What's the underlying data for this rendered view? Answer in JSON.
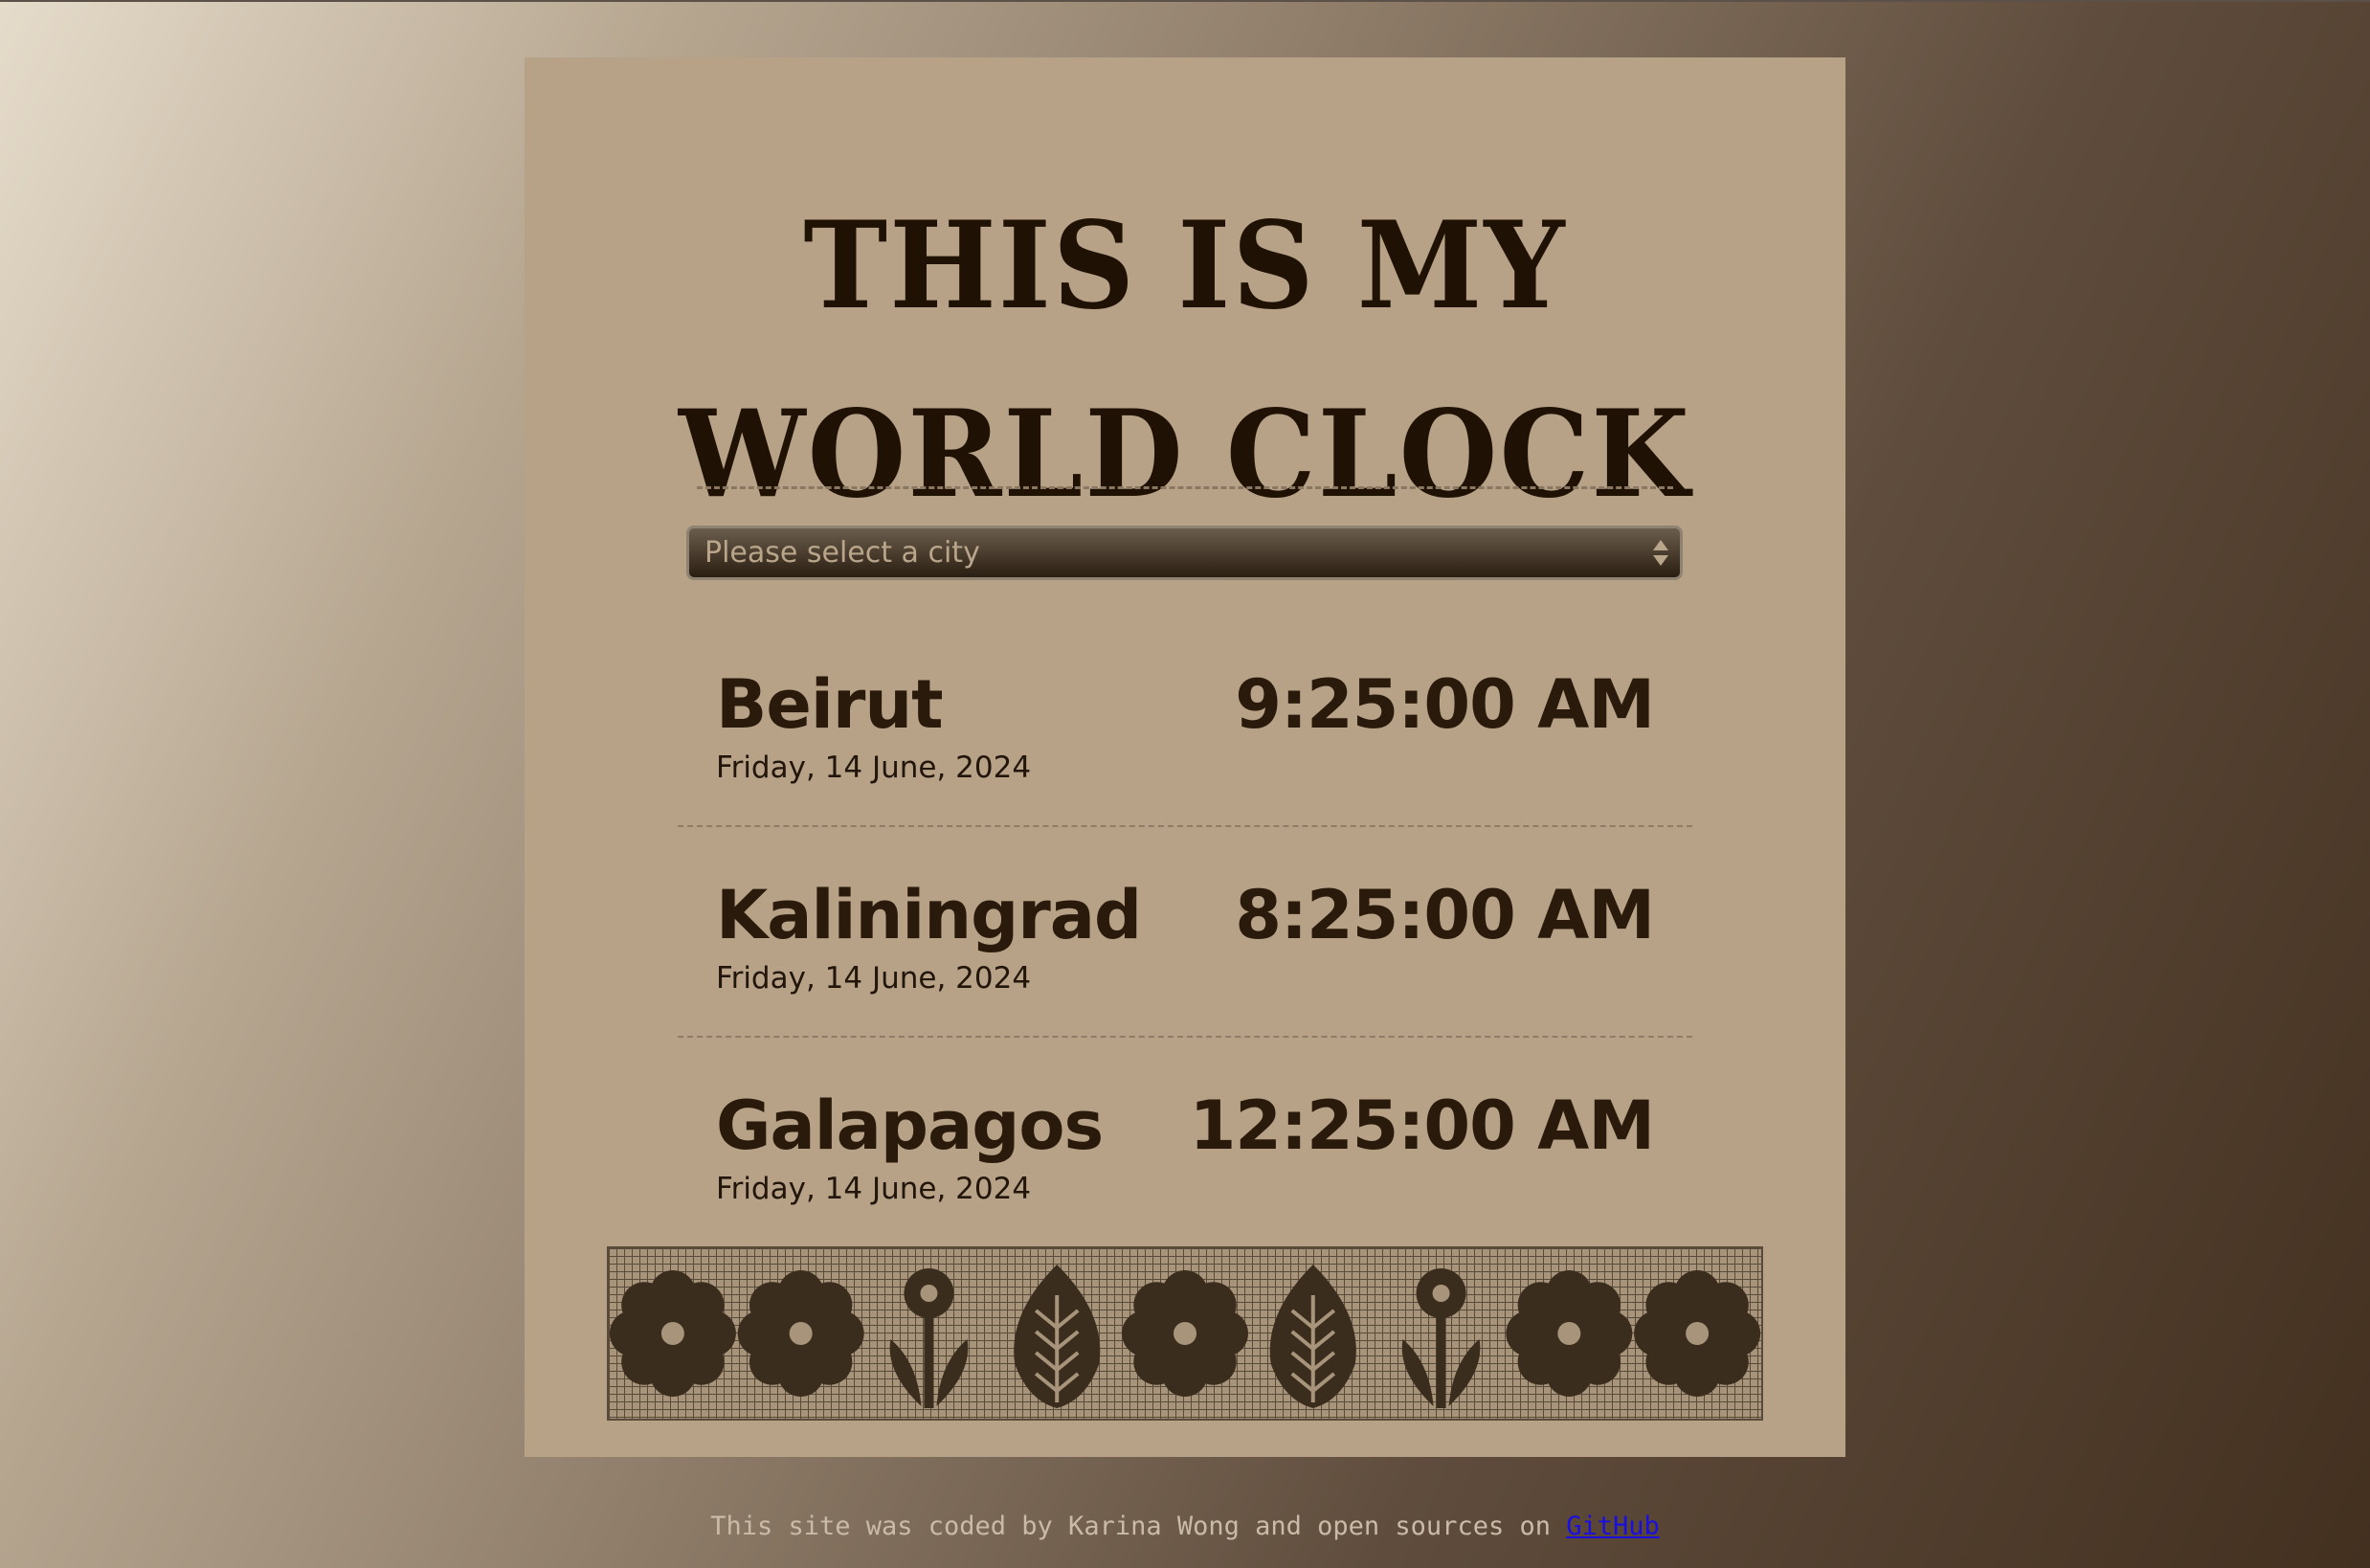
{
  "header": {
    "title_line1": "This is my",
    "title_line2": "World Clock"
  },
  "city_select": {
    "placeholder": "Please select a city"
  },
  "cities": [
    {
      "name": "Beirut",
      "date": "Friday, 14 June, 2024",
      "time": "9:25:00 AM"
    },
    {
      "name": "Kaliningrad",
      "date": "Friday, 14 June, 2024",
      "time": "8:25:00 AM"
    },
    {
      "name": "Galapagos",
      "date": "Friday, 14 June, 2024",
      "time": "12:25:00 AM"
    }
  ],
  "decoration": {
    "motifs": [
      "flower-icon",
      "flower-icon",
      "tulip-icon",
      "leaf-icon",
      "flower-icon",
      "leaf-icon",
      "tulip-icon",
      "flower-icon",
      "flower-icon"
    ],
    "color": "#3a2d1e"
  },
  "footer": {
    "text": "This site was coded by Karina Wong and open sources on",
    "link_text": "GitHub"
  },
  "colors": {
    "card": "#b7a187",
    "text": "#1f1104",
    "link": "#1a0ee0"
  }
}
